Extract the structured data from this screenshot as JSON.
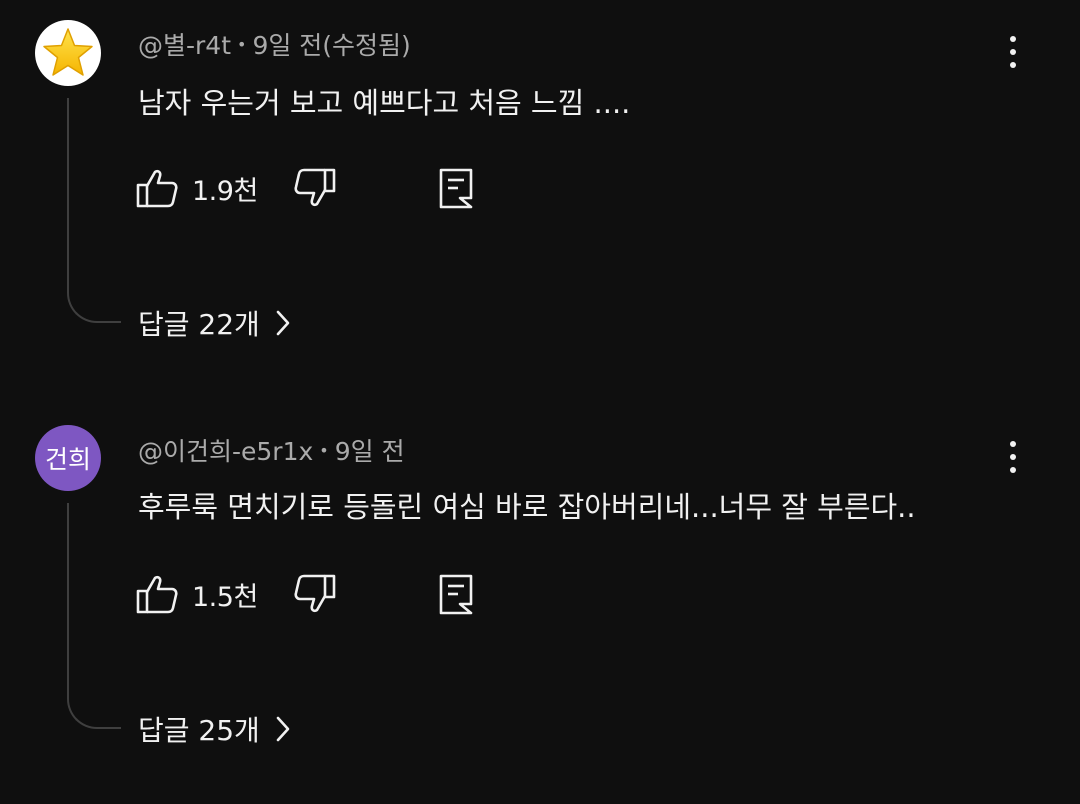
{
  "comments": [
    {
      "avatar_icon": "star-icon",
      "avatar_bg": "#ffffff",
      "handle": "@별-r4t",
      "separator": "•",
      "time": "9일 전(수정됨)",
      "text": "남자 우는거 보고 예쁘다고 처음 느낌 ....",
      "likes": "1.9천",
      "replies_label": "답글 22개"
    },
    {
      "avatar_initials": "건희",
      "avatar_bg": "#7e57c2",
      "handle": "@이건희-e5r1x",
      "separator": "•",
      "time": "9일 전",
      "text": "후루룩 면치기로 등돌린 여심 바로 잡아버리네...너무 잘 부른다..",
      "likes": "1.5천",
      "replies_label": "답글 25개"
    }
  ],
  "icons": {
    "like": "thumbs-up-icon",
    "dislike": "thumbs-down-icon",
    "reply": "reply-icon",
    "more": "more-vertical-icon",
    "chevron": "chevron-right-icon"
  },
  "colors": {
    "background": "#0f0f0f",
    "text": "#f1f1f1",
    "meta": "#aaaaaa",
    "thread_line": "#3f3f3f"
  }
}
